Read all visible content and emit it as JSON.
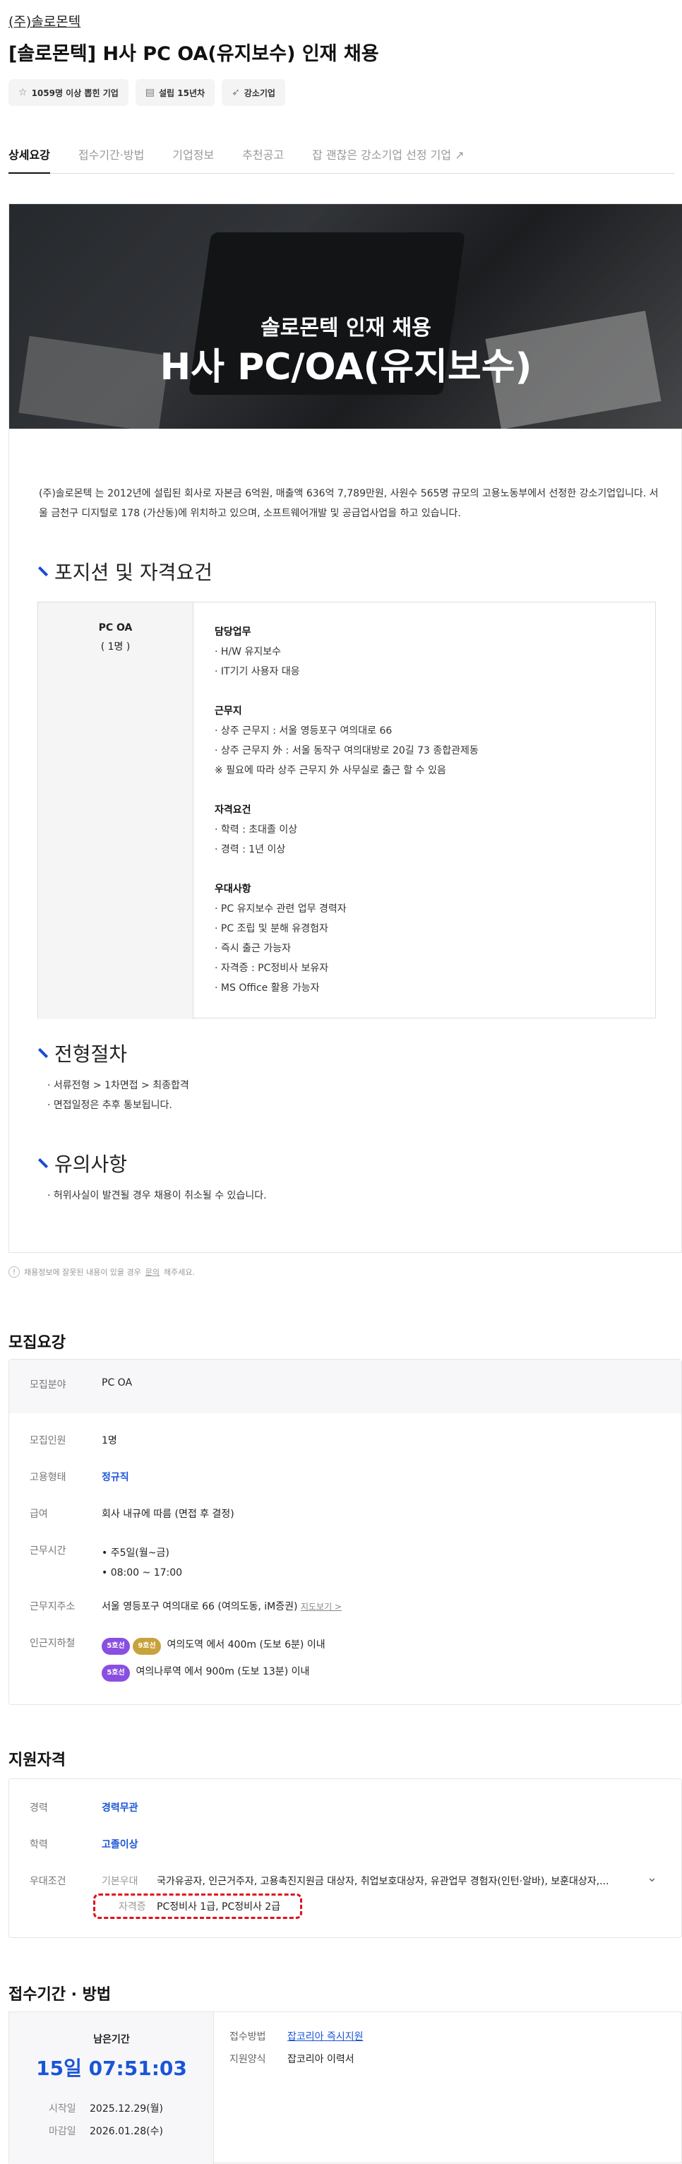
{
  "company": "(주)솔로몬텍",
  "title": "[솔로몬텍] H사 PC OA(유지보수) 인재 채용",
  "badges": [
    {
      "icon": "star-icon",
      "label": "1059명 이상 뽑힌 기업"
    },
    {
      "icon": "scroll-icon",
      "label": "설립 15년차"
    },
    {
      "icon": "rocket-icon",
      "label": "강소기업"
    }
  ],
  "tabs": [
    "상세요강",
    "접수기간·방법",
    "기업정보",
    "추천공고",
    "잡 괜찮은 강소기업 선정 기업"
  ],
  "banner": {
    "sub": "솔로몬텍 인재 채용",
    "main": "H사 PC/OA(유지보수)"
  },
  "intro": "(주)솔로몬텍 는 2012년에 설립된 회사로 자본금 6억원, 매출액 636억 7,789만원, 사원수 565명 규모의 고용노동부에서 선정한 강소기업입니다. 서울 금천구 디지털로 178 (가산동)에 위치하고 있으며, 소프트웨어개발 및 공급업사업을 하고 있습니다.",
  "sections": {
    "position": "포지션 및 자격요건",
    "process": "전형절차",
    "caution": "유의사항"
  },
  "position_table": {
    "name": "PC OA",
    "count": "( 1명 )",
    "blocks": [
      {
        "head": "담당업무",
        "items": [
          "· H/W 유지보수",
          "· IT기기 사용자 대응"
        ]
      },
      {
        "head": "근무지",
        "items": [
          "· 상주 근무지 : 서울 영등포구 여의대로 66",
          "· 상주 근무지 外 : 서울 동작구 여의대방로 20길 73 종합관제동",
          "※ 필요에 따라 상주 근무지 外 사무실로 출근 할 수 있음"
        ]
      },
      {
        "head": "자격요건",
        "items": [
          "· 학력 : 초대졸 이상",
          "· 경력 : 1년 이상"
        ]
      },
      {
        "head": "우대사항",
        "items": [
          "· PC 유지보수 관련 업무 경력자",
          "· PC 조립 및 분해 유경험자",
          "· 즉시 출근 가능자",
          "· 자격증 : PC정비사 보유자",
          "· MS Office 활용 가능자"
        ]
      }
    ]
  },
  "process": [
    "· 서류전형 > 1차면접 > 최종합격",
    "· 면접일정은 추후 통보됩니다."
  ],
  "caution": [
    "· 허위사실이 발견될 경우 채용이 취소될 수 있습니다."
  ],
  "notice": {
    "pre": "채용정보에 잘못된 내용이 있을 경우 ",
    "link": "문의",
    "post": "해주세요."
  },
  "recruit": {
    "heading": "모집요강",
    "field_label": "모집분야",
    "field_value": "PC OA",
    "count_label": "모집인원",
    "count_value": "1명",
    "type_label": "고용형태",
    "type_value": "정규직",
    "salary_label": "급여",
    "salary_value": "회사 내규에 따름 (면접 후 결정)",
    "hours_label": "근무시간",
    "hours_values": [
      "주5일(월~금)",
      "08:00 ~ 17:00"
    ],
    "addr_label": "근무지주소",
    "addr_value": "서울 영등포구 여의대로 66 (여의도동, iM증권)",
    "addr_link": "지도보기 >",
    "subway_label": "인근지하철",
    "subways": [
      {
        "lines": [
          {
            "name": "5호선",
            "color": "#8a4fe0"
          },
          {
            "name": "9호선",
            "color": "#c8a23a"
          }
        ],
        "text": "여의도역 에서 400m (도보 6분) 이내"
      },
      {
        "lines": [
          {
            "name": "5호선",
            "color": "#8a4fe0"
          }
        ],
        "text": "여의나루역 에서 900m (도보 13분) 이내"
      }
    ]
  },
  "qualify": {
    "heading": "지원자격",
    "career_label": "경력",
    "career_value": "경력무관",
    "edu_label": "학력",
    "edu_value": "고졸이상",
    "pref_label": "우대조건",
    "basic_label": "기본우대",
    "basic_value": "국가유공자, 인근거주자, 고용촉진지원금 대상자, 취업보호대상자, 유관업무 경험자(인턴·알바), 보훈대상자,...",
    "cert_label": "자격증",
    "cert_value": "PC정비사 1급, PC정비사 2급"
  },
  "period": {
    "heading": "접수기간 · 방법",
    "remain_label": "남은기간",
    "remain_value": "15일 07:51:03",
    "start_label": "시작일",
    "start_value": "2025.12.29(월)",
    "end_label": "마감일",
    "end_value": "2026.01.28(수)",
    "method_label": "접수방법",
    "method_value": "잡코리아 즉시지원",
    "form_label": "지원양식",
    "form_value": "잡코리아 이력서"
  }
}
